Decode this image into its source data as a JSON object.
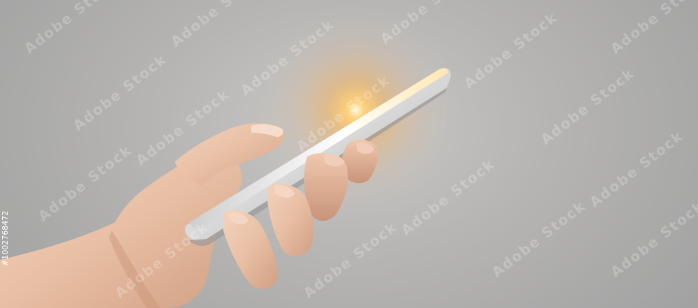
{
  "image": {
    "subject": "hand holding a smartphone with glowing light",
    "background_color": "#b4b4b3",
    "glow_color": "#ffc266"
  },
  "watermark": {
    "text": "Adobe Stock",
    "icon": "adobe-stock-logo-icon"
  },
  "stock_id": {
    "text": "#1002768472"
  }
}
